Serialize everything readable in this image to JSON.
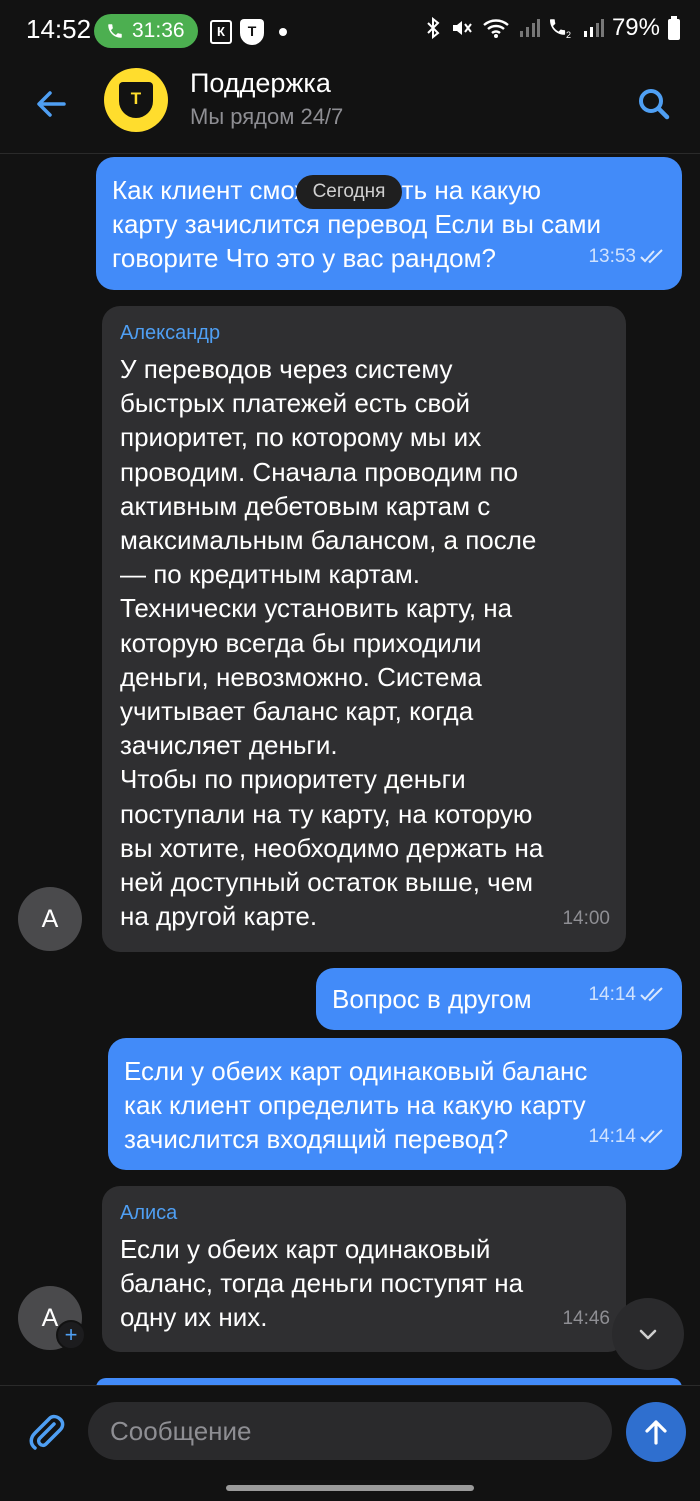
{
  "status_bar": {
    "time": "14:52",
    "call_duration": "31:36",
    "battery": "79%"
  },
  "header": {
    "title": "Поддержка",
    "subtitle": "Мы рядом 24/7",
    "logo_letter": "Т"
  },
  "date_divider": "Сегодня",
  "messages": [
    {
      "direction": "out",
      "text": "Как клиент сможет понять на какую\nкарту зачислится перевод Если вы сами\nговорите Что это у вас рандом?",
      "time": "13:53",
      "read": true
    },
    {
      "direction": "in",
      "sender": "Александр",
      "avatar_letter": "А",
      "text": "У переводов через систему\nбыстрых платежей есть свой\nприоритет, по которому мы их\nпроводим. Сначала проводим по\nактивным дебетовым картам с\nмаксимальным балансом, а после\n— по кредитным картам.\nТехнически установить карту, на\nкоторую всегда бы приходили\nденьги, невозможно. Система\nучитывает баланс карт, когда\nзачисляет деньги.\nЧтобы по приоритету деньги\nпоступали на ту карту, на которую\nвы хотите, необходимо держать на\nней доступный остаток выше, чем\nна другой карте.",
      "time": "14:00"
    },
    {
      "direction": "out",
      "text": "Вопрос в другом",
      "time": "14:14",
      "read": true
    },
    {
      "direction": "out",
      "text": "Если у обеих карт одинаковый баланс\nкак клиент определить на какую карту\nзачислится входящий перевод?",
      "time": "14:14",
      "read": true
    },
    {
      "direction": "in",
      "sender": "Алиса",
      "avatar_letter": "А",
      "text": "Если у обеих карт одинаковый\nбаланс, тогда деньги поступят на\nодну их них.",
      "time": "14:46"
    }
  ],
  "composer": {
    "placeholder": "Сообщение"
  },
  "colors": {
    "background": "#121212",
    "outgoing_bubble": "#428bf9",
    "incoming_bubble": "#2f2f31",
    "accent": "#4f9ff3",
    "brand_yellow": "#ffdd2d"
  },
  "icons": {
    "back": "arrow-left-icon",
    "search": "search-icon",
    "attach": "paperclip-icon",
    "send": "arrow-up-icon",
    "scroll": "chevron-down-icon",
    "read": "double-check-icon"
  }
}
